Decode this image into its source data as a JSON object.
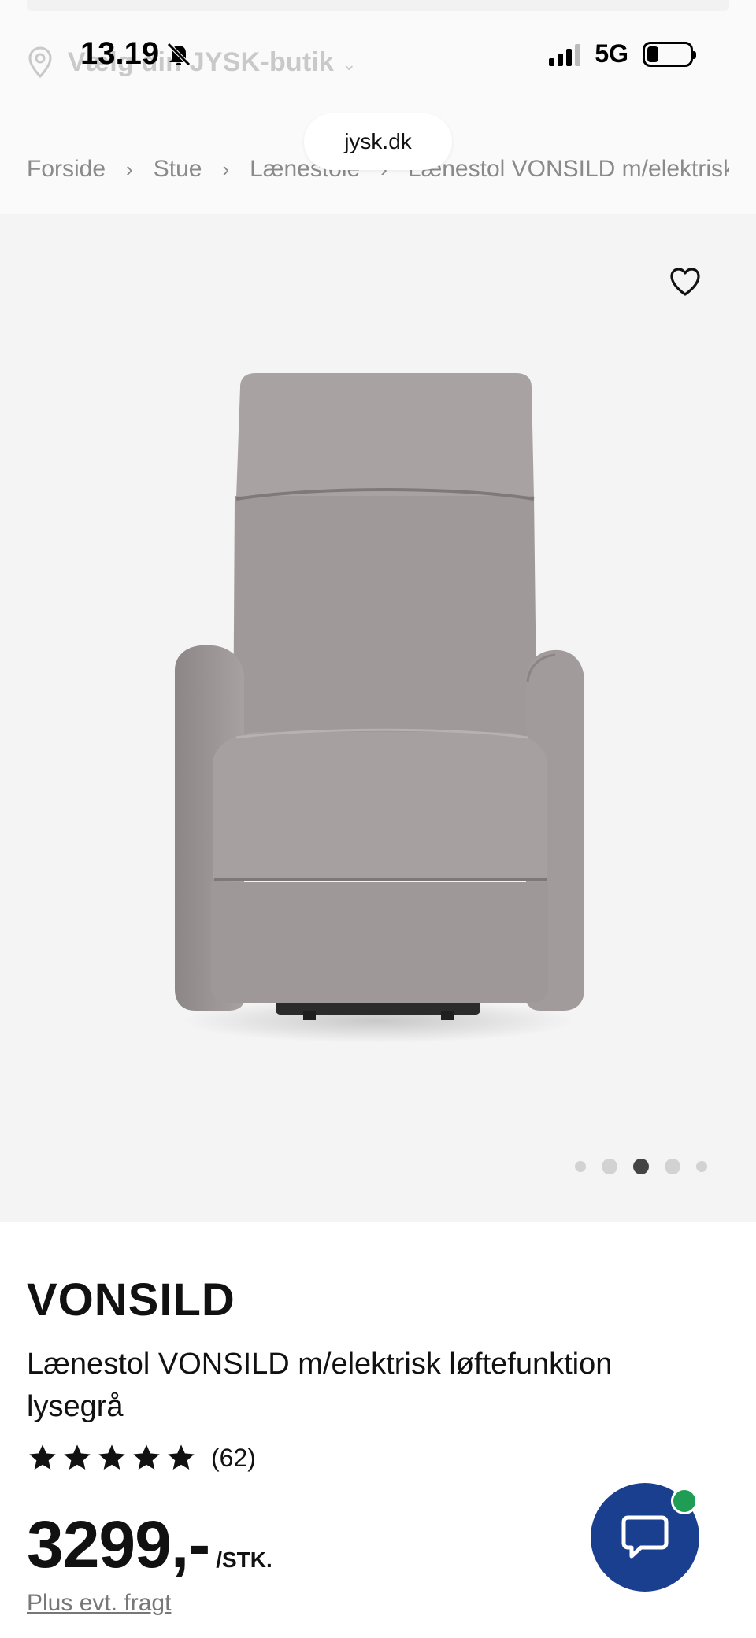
{
  "status_bar": {
    "time": "13.19",
    "network": "5G"
  },
  "header": {
    "store_selector": "Vælg din JYSK-butik",
    "url": "jysk.dk"
  },
  "breadcrumb": [
    "Forside",
    "Stue",
    "Lænestole",
    "Lænestol VONSILD m/elektrisk"
  ],
  "gallery": {
    "image_count": 5,
    "active_index": 2
  },
  "product": {
    "brand": "VONSILD",
    "description": "Lænestol VONSILD m/elektrisk løftefunktion lysegrå",
    "rating": 5,
    "review_count": "(62)",
    "price": "3299,-",
    "unit": "/STK.",
    "shipping_note": "Plus evt. fragt"
  },
  "colors": {
    "chat_blue": "#1a3f8f",
    "online_green": "#1f9d55",
    "gallery_bg": "#f4f4f4"
  }
}
